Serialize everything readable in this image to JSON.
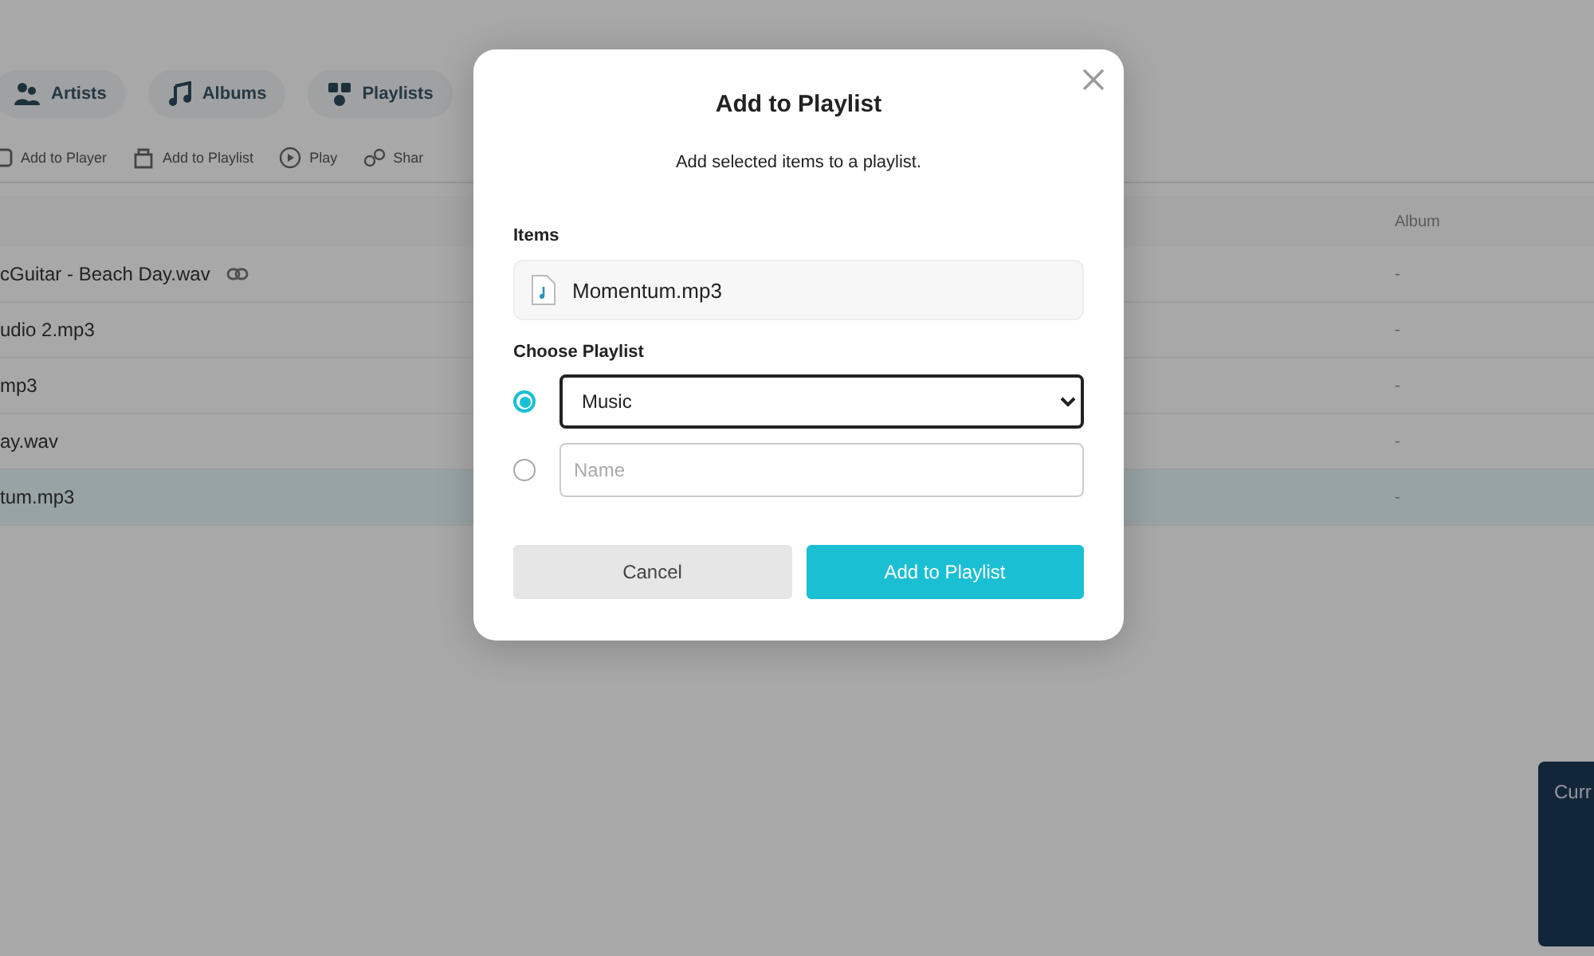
{
  "background": {
    "nav_tabs": [
      {
        "label": "Artists"
      },
      {
        "label": "Albums"
      },
      {
        "label": "Playlists"
      }
    ],
    "toolbar": [
      {
        "label": "Add to Player"
      },
      {
        "label": "Add to Playlist"
      },
      {
        "label": "Play"
      },
      {
        "label": "Shar"
      }
    ],
    "table": {
      "columns": [
        {
          "label": "Album"
        }
      ],
      "rows": [
        {
          "name": "cGuitar - Beach Day.wav",
          "album": "-",
          "shared": true,
          "selected": false
        },
        {
          "name": "udio 2.mp3",
          "album": "-",
          "shared": false,
          "selected": false
        },
        {
          "name": "mp3",
          "album": "-",
          "shared": false,
          "selected": false
        },
        {
          "name": "ay.wav",
          "album": "-",
          "shared": false,
          "selected": false
        },
        {
          "name": "tum.mp3",
          "album": "-",
          "shared": false,
          "selected": true
        }
      ]
    },
    "now_playing_card": {
      "title": "Curr"
    }
  },
  "dialog": {
    "title": "Add to Playlist",
    "subtitle": "Add selected items to a playlist.",
    "items_label": "Items",
    "items": [
      {
        "name": "Momentum.mp3"
      }
    ],
    "playlist_label": "Choose Playlist",
    "options": [
      {
        "kind": "select",
        "selected": true,
        "value": "Music"
      },
      {
        "kind": "input",
        "selected": false,
        "placeholder": "Name"
      }
    ],
    "buttons": [
      {
        "kind": "secondary",
        "label": "Cancel"
      },
      {
        "kind": "primary",
        "label": "Add to Playlist"
      }
    ]
  }
}
